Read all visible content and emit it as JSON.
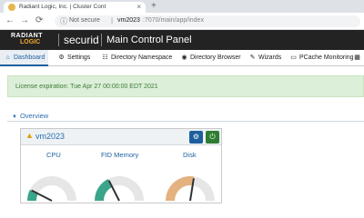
{
  "browser": {
    "tab_title": "Radiant Logic, Inc. | Cluster Cont",
    "tab_close": "×",
    "new_tab": "+",
    "back": "←",
    "forward": "→",
    "reload": "⟳",
    "info_icon": "ⓘ",
    "security_text": "Not secure",
    "url_sep": "|",
    "url_host": "vm2023",
    "url_path": ":7070/main/app/index"
  },
  "app": {
    "logo_line1": "RADIANT",
    "logo_line2": "LOGIC",
    "product": "securid",
    "title": "Main Control Panel"
  },
  "nav": {
    "tabs": [
      {
        "icon": "home-icon",
        "glyph": "⌂",
        "label": "Dashboard",
        "active": true
      },
      {
        "icon": "gear-icon",
        "glyph": "⚙",
        "label": "Settings"
      },
      {
        "icon": "sitemap-icon",
        "glyph": "☷",
        "label": "Directory Namespace"
      },
      {
        "icon": "globe-icon",
        "glyph": "◉",
        "label": "Directory Browser"
      },
      {
        "icon": "wand-icon",
        "glyph": "✎",
        "label": "Wizards"
      },
      {
        "icon": "monitor-icon",
        "glyph": "▭",
        "label": "PCache Monitoring"
      },
      {
        "icon": "chart-icon",
        "glyph": "▦",
        "label": ""
      }
    ]
  },
  "alert": {
    "text": "License expiration: Tue Apr 27 00:00:00 EDT 2021"
  },
  "overview": {
    "caret": "▼",
    "label": "Overview"
  },
  "server": {
    "warn_glyph": "▲",
    "name": "vm2023",
    "dash_glyph": "⚙",
    "power_glyph": "⏻",
    "gauges": [
      {
        "label": "CPU",
        "level": 0.15,
        "color": "#3aa58a"
      },
      {
        "label": "FID Memory",
        "level": 0.35,
        "color": "#3aa58a"
      },
      {
        "label": "Disk",
        "level": 0.55,
        "color": "#e3b27f"
      }
    ]
  },
  "colors": {
    "header_bg": "#232323",
    "accent": "#1d5f9e",
    "alert_bg": "#dcefd8",
    "gauge_low": "#3aa58a",
    "gauge_high": "#e3b27f"
  }
}
